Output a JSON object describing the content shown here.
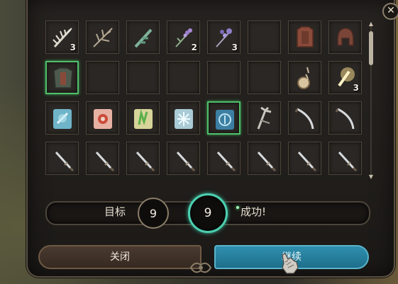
{
  "window": {
    "close_symbol": "✕"
  },
  "inventory": {
    "rows": [
      [
        {
          "icon": "feather-bundle-icon",
          "qty": "3"
        },
        {
          "icon": "dry-herb-icon",
          "qty": ""
        },
        {
          "icon": "green-herb-icon",
          "qty": ""
        },
        {
          "icon": "lavender-icon",
          "qty": "2"
        },
        {
          "icon": "purple-flower-icon",
          "qty": "3"
        },
        {
          "icon": "",
          "qty": ""
        },
        {
          "icon": "leather-armor-icon",
          "qty": ""
        },
        {
          "icon": "helmet-icon",
          "qty": ""
        }
      ],
      [
        {
          "icon": "chest-armor-icon",
          "qty": "",
          "selected": true
        },
        {
          "icon": "",
          "qty": ""
        },
        {
          "icon": "",
          "qty": ""
        },
        {
          "icon": "",
          "qty": ""
        },
        {
          "icon": "",
          "qty": ""
        },
        {
          "icon": "",
          "qty": ""
        },
        {
          "icon": "potion-flask-icon",
          "qty": ""
        },
        {
          "icon": "glowing-shard-icon",
          "qty": "3"
        }
      ],
      [
        {
          "icon": "blue-scroll-icon",
          "qty": ""
        },
        {
          "icon": "red-scroll-icon",
          "qty": ""
        },
        {
          "icon": "green-scroll-icon",
          "qty": ""
        },
        {
          "icon": "ice-scroll-icon",
          "qty": ""
        },
        {
          "icon": "rune-scroll-icon",
          "qty": "",
          "selected": true
        },
        {
          "icon": "bone-claw-icon",
          "qty": ""
        },
        {
          "icon": "curved-blade-icon",
          "qty": ""
        },
        {
          "icon": "curved-blade-icon",
          "qty": ""
        }
      ],
      [
        {
          "icon": "dagger-icon",
          "qty": ""
        },
        {
          "icon": "dagger-icon",
          "qty": ""
        },
        {
          "icon": "dagger-icon",
          "qty": ""
        },
        {
          "icon": "dagger-icon",
          "qty": ""
        },
        {
          "icon": "dagger-icon",
          "qty": ""
        },
        {
          "icon": "dagger-icon",
          "qty": ""
        },
        {
          "icon": "dagger-icon",
          "qty": ""
        },
        {
          "icon": "dagger-icon",
          "qty": ""
        }
      ]
    ]
  },
  "roll": {
    "target_label": "目标",
    "target_value": "9",
    "result_value": "9",
    "result_text": "成功!",
    "accent_color": "#4cd0b0"
  },
  "buttons": {
    "close_label": "关闭",
    "continue_label": "继续"
  },
  "colors": {
    "selected_border": "#4fbf6a",
    "continue_button": "#2f8fad"
  }
}
